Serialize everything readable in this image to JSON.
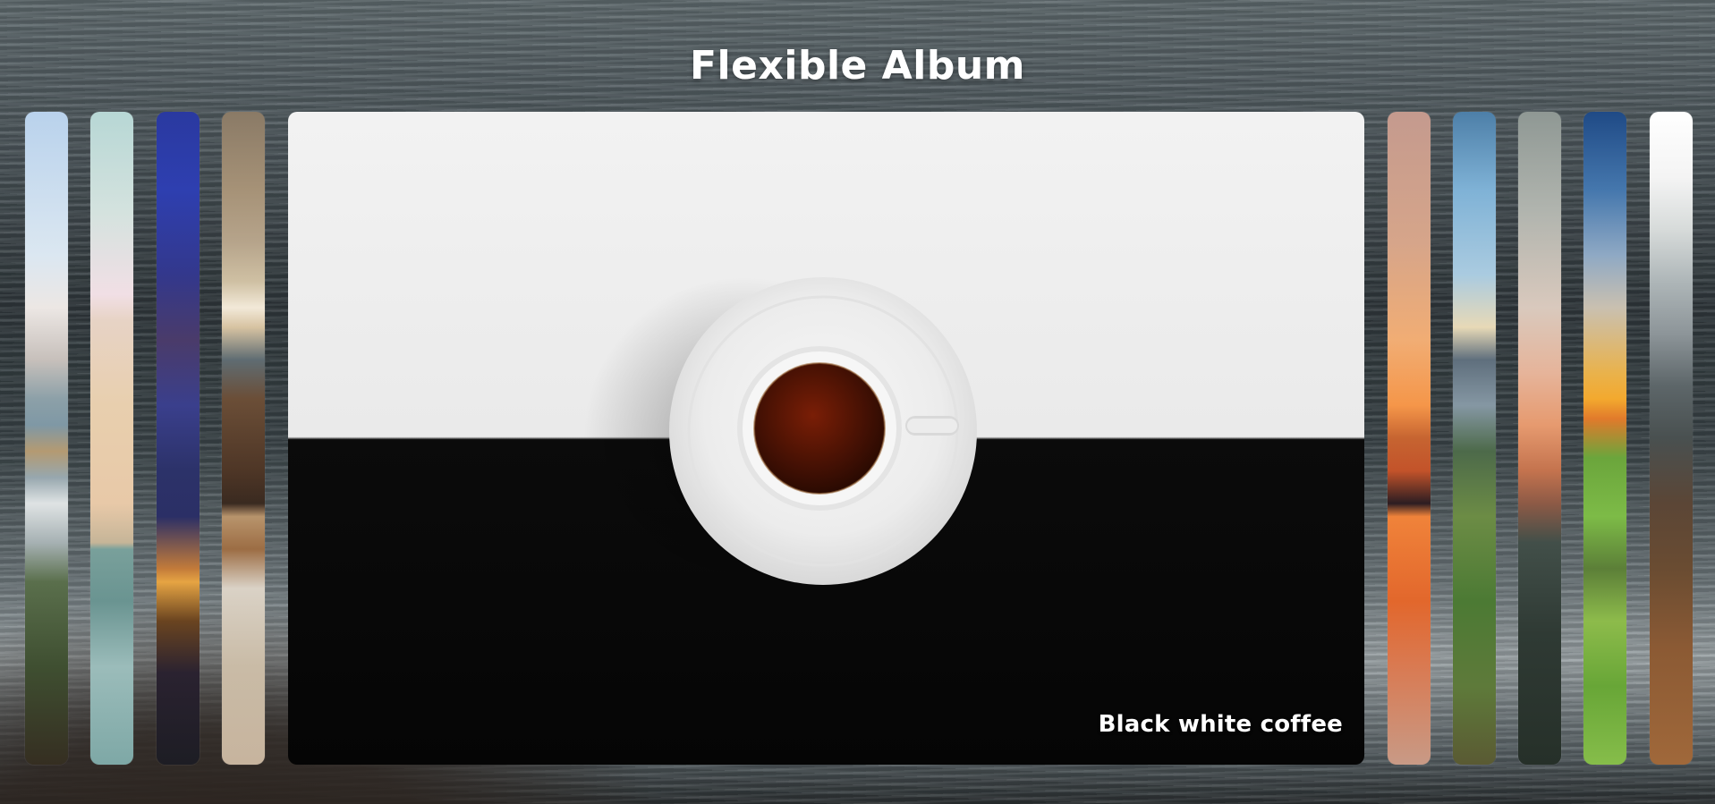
{
  "page": {
    "title": "Flexible Album"
  },
  "album": {
    "active_index": 4,
    "active_caption": "Black white coffee",
    "items": [
      {
        "theme": "coastline",
        "active": false
      },
      {
        "theme": "bridge-mist",
        "active": false
      },
      {
        "theme": "bridge-night",
        "active": false
      },
      {
        "theme": "coffee-cups",
        "active": false
      },
      {
        "theme": "black-white-coffee",
        "active": true,
        "caption": "Black white coffee"
      },
      {
        "theme": "sunset-trees",
        "active": false
      },
      {
        "theme": "green-hills",
        "active": false
      },
      {
        "theme": "dusk-mountain",
        "active": false
      },
      {
        "theme": "sunrise-meadow",
        "active": false
      },
      {
        "theme": "mountain-forest",
        "active": false
      }
    ]
  },
  "colors": {
    "title_text": "#ffffff",
    "caption_text": "#ffffff"
  }
}
